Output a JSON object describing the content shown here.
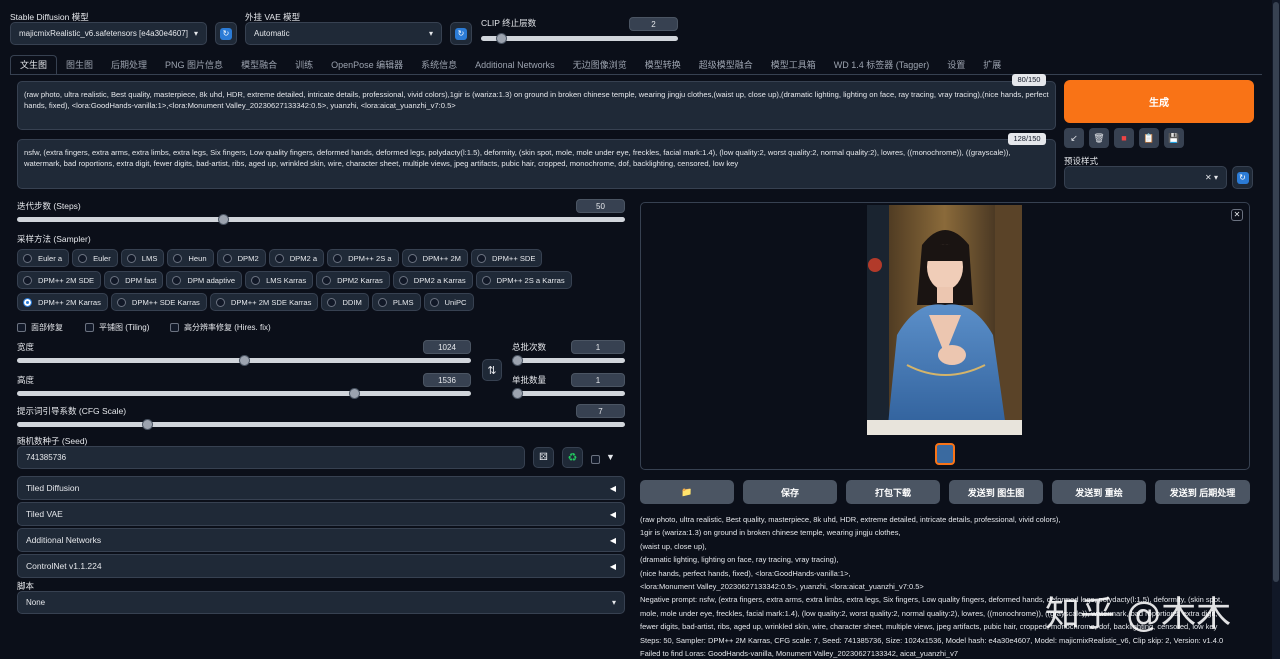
{
  "top": {
    "model_label": "Stable Diffusion 模型",
    "model_value": "majicmixRealistic_v6.safetensors [e4a30e4607]",
    "vae_label": "外挂 VAE 模型",
    "vae_value": "Automatic",
    "clip_label": "CLIP 终止层数",
    "clip_value": "2",
    "clip_fraction": 0.083
  },
  "tabs": [
    "文生图",
    "图生图",
    "后期处理",
    "PNG 图片信息",
    "模型融合",
    "训练",
    "OpenPose 编辑器",
    "系统信息",
    "Additional Networks",
    "无边图像浏览",
    "模型转换",
    "超级模型融合",
    "模型工具箱",
    "WD 1.4 标签器 (Tagger)",
    "设置",
    "扩展"
  ],
  "prompt": {
    "text": "(raw photo, ultra realistic, Best quality, masterpiece, 8k uhd, HDR, extreme detailed, intricate details, professional, vivid colors),1gir is (wariza:1.3) on ground in broken chinese temple, wearing jingju clothes,(waist up, close up),(dramatic lighting, lighting on face, ray tracing, vray tracing),(nice hands, perfect hands, fixed), <lora:GoodHands-vanilla:1>,<lora:Monument Valley_20230627133342:0.5>, yuanzhi, <lora:aicat_yuanzhi_v7:0.5>",
    "counter": "80/150"
  },
  "negative": {
    "text": "nsfw, (extra fingers, extra arms, extra limbs, extra legs, Six fingers, Low quality fingers, deformed hands, deformed legs, polydacty(l:1.5), deformity, (skin spot, mole, mole under eye, freckles, facial mark:1.4), (low quality:2, worst quality:2, normal quality:2), lowres, ((monochrome)), ((grayscale)), watermark,  bad roportions,  extra digit, fewer digits, bad-artist, ribs, aged up, wrinkled skin, wire, character sheet, multiple views, jpeg artifacts, pubic hair, cropped, monochrome, dof, backlighting, censored, low key",
    "counter": "128/150"
  },
  "generate": {
    "label": "生成",
    "style_label": "预设样式",
    "color": "#f97316"
  },
  "steps": {
    "label": "迭代步数 (Steps)",
    "value": "50",
    "fraction": 0.337
  },
  "sampler": {
    "label": "采样方法 (Sampler)",
    "options": [
      "Euler a",
      "Euler",
      "LMS",
      "Heun",
      "DPM2",
      "DPM2 a",
      "DPM++ 2S a",
      "DPM++ 2M",
      "DPM++ SDE",
      "DPM++ 2M SDE",
      "DPM fast",
      "DPM adaptive",
      "LMS Karras",
      "DPM2 Karras",
      "DPM2 a Karras",
      "DPM++ 2S a Karras",
      "DPM++ 2M Karras",
      "DPM++ SDE Karras",
      "DPM++ 2M SDE Karras",
      "DDIM",
      "PLMS",
      "UniPC"
    ],
    "selected": "DPM++ 2M Karras"
  },
  "checks": {
    "face": "面部修复",
    "tiling": "平铺图 (Tiling)",
    "hires": "高分辨率修复 (Hires. fix)"
  },
  "width": {
    "label": "宽度",
    "value": "1024",
    "fraction": 0.5
  },
  "height": {
    "label": "高度",
    "value": "1536",
    "fraction": 0.75
  },
  "batch_count": {
    "label": "总批次数",
    "value": "1",
    "fraction": 0.0
  },
  "batch_size": {
    "label": "单批数量",
    "value": "1",
    "fraction": 0.0
  },
  "cfg": {
    "label": "提示词引导系数 (CFG Scale)",
    "value": "7",
    "fraction": 0.21
  },
  "seed": {
    "label": "随机数种子 (Seed)",
    "value": "741385736"
  },
  "accordions": [
    "Tiled Diffusion",
    "Tiled VAE",
    "Additional Networks",
    "ControlNet v1.1.224"
  ],
  "script": {
    "label": "脚本",
    "value": "None"
  },
  "actions": {
    "folder_icon": "folder-icon",
    "save": "保存",
    "zip": "打包下载",
    "to_img2img": "发送到 图生图",
    "to_inpaint": "发送到 重绘",
    "to_extras": "发送到 后期处理"
  },
  "output_info": [
    "(raw photo, ultra realistic, Best quality, masterpiece, 8k uhd, HDR, extreme detailed, intricate details, professional, vivid colors),",
    "1gir is (wariza:1.3) on ground in broken chinese temple, wearing jingju clothes,",
    "(waist up, close up),",
    "(dramatic lighting, lighting on face, ray tracing, vray tracing),",
    "(nice hands, perfect hands, fixed), <lora:GoodHands-vanilla:1>,",
    "<lora:Monument Valley_20230627133342:0.5>, yuanzhi, <lora:aicat_yuanzhi_v7:0.5>",
    "Negative prompt: nsfw, (extra fingers, extra arms, extra limbs, extra legs, Six fingers, Low quality fingers, deformed hands, deformed legs, polydacty(l:1.5), deformity, (skin spot,",
    "mole, mole under eye, freckles, facial mark:1.4), (low quality:2, worst quality:2, normal quality:2), lowres, ((monochrome)), ((grayscale)), watermark, bad roportions, extra digit,",
    "fewer digits, bad-artist, ribs, aged up, wrinkled skin, wire, character sheet, multiple views, jpeg artifacts, pubic hair, cropped, monochrome, dof, backlighting, censored, low key",
    "Steps: 50, Sampler: DPM++ 2M Karras, CFG scale: 7, Seed: 741385736, Size: 1024x1536, Model hash: e4a30e4607, Model: majicmixRealistic_v6, Clip skip: 2, Version: v1.4.0",
    "Failed to find Loras: GoodHands-vanilla, Monument Valley_20230627133342, aicat_yuanzhi_v7"
  ],
  "watermark": "知乎 @木木"
}
